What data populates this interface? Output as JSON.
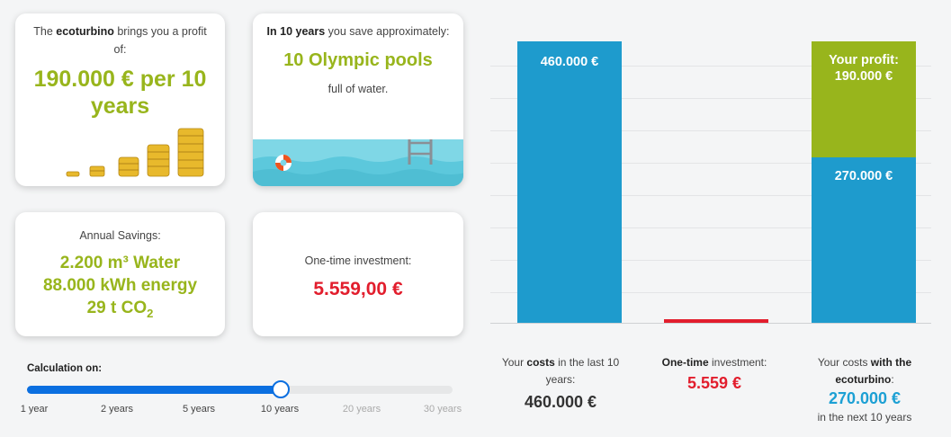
{
  "cards": {
    "profit": {
      "pre": "The ",
      "brand": "ecoturbino",
      "post": " brings you a profit of:",
      "value": "190.000 € per 10 years",
      "icon": "coin-stacks-icon"
    },
    "pools": {
      "lead_bold": "In 10 years",
      "lead_rest": " you save approximately:",
      "value": "10 Olympic pools",
      "sub": "full of water.",
      "icon": "swimming-pool-icon"
    },
    "annual": {
      "title": "Annual Savings:",
      "water": "2.200 m³ Water",
      "energy": "88.000 kWh energy",
      "co2_prefix": "29 t CO",
      "co2_sub": "2"
    },
    "invest": {
      "title": "One-time investment:",
      "value": "5.559,00 €"
    }
  },
  "slider": {
    "label": "Calculation on:",
    "options": [
      "1 year",
      "2 years",
      "5 years",
      "10 years",
      "20 years",
      "30 years"
    ],
    "selected_index": 3,
    "fill_fraction": 0.597,
    "accent": "#0b6fe0"
  },
  "chart_data": {
    "type": "bar",
    "categories": [
      "Your costs in the last 10 years",
      "One-time investment",
      "Your costs with the ecoturbino"
    ],
    "series": [
      {
        "values": [
          460000,
          5559,
          270000
        ],
        "colors": [
          "#1e9bcd",
          "#e21e2d",
          "#1e9bcd"
        ]
      },
      {
        "values": [
          0,
          0,
          190000
        ],
        "colors": [
          "#98b51c",
          "#98b51c",
          "#98b51c"
        ]
      }
    ],
    "bar_labels": {
      "costs": "460.000 €",
      "with_base": "270.000 €",
      "profit_title": "Your profit:",
      "profit_value": "190.000 €"
    },
    "ylim": [
      0,
      460000
    ],
    "grid": true
  },
  "captions": {
    "costs": {
      "pre": "Your ",
      "bold": "costs",
      "post": " in the last 10 years:",
      "value": "460.000 €"
    },
    "invest": {
      "bold": "One-time",
      "post": " investment:",
      "value": "5.559 €"
    },
    "with": {
      "pre": "Your costs ",
      "bold1": "with the",
      "bold2": "ecoturbino",
      "post": ":",
      "value": "270.000 €",
      "sub": "in the next 10 years"
    }
  }
}
